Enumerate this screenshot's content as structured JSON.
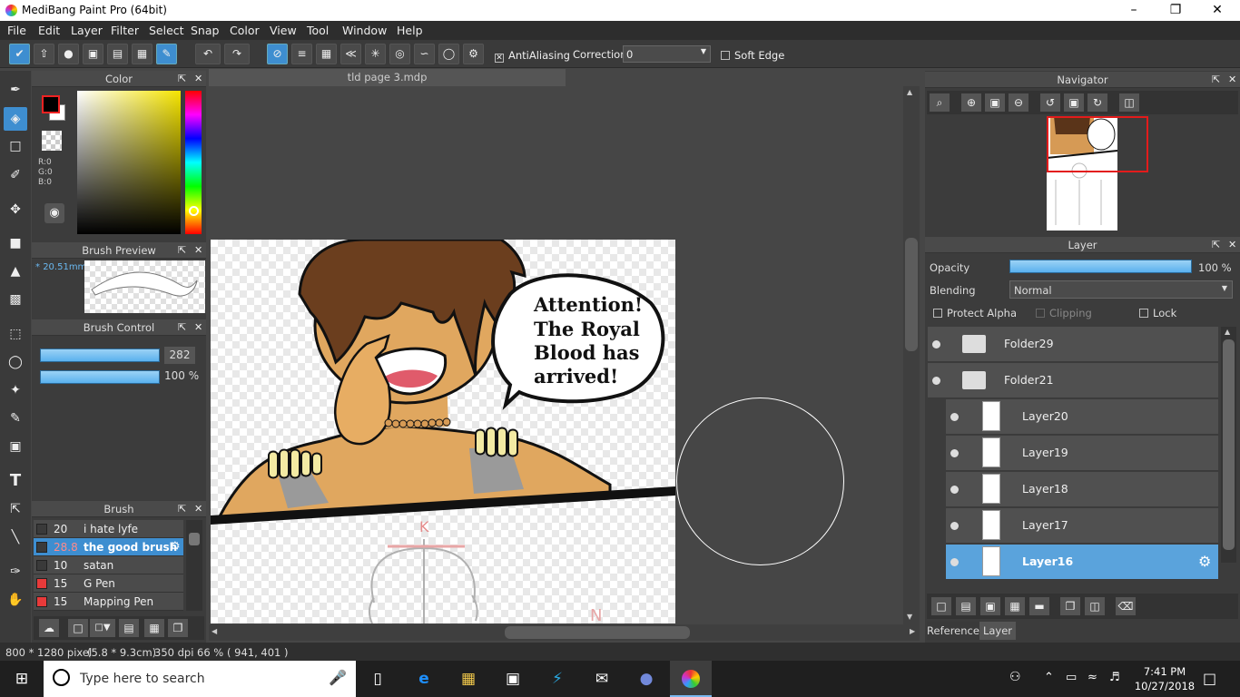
{
  "window": {
    "title": "MediBang Paint Pro (64bit)"
  },
  "menu": [
    "File",
    "Edit",
    "Layer",
    "Filter",
    "Select",
    "Snap",
    "Color",
    "View",
    "Tool",
    "Window",
    "Help"
  ],
  "toolbar": {
    "antialiasing_label": "AntiAliasing",
    "correction_label": "Correction",
    "correction_value": "0",
    "soft_edge_label": "Soft Edge"
  },
  "color_panel": {
    "title": "Color",
    "r": "R:0",
    "g": "G:0",
    "b": "B:0"
  },
  "brush_preview": {
    "title": "Brush Preview",
    "size": "20.51mm"
  },
  "brush_control": {
    "title": "Brush Control",
    "size_value": "282",
    "opacity_value": "100 %"
  },
  "brush_panel": {
    "title": "Brush",
    "items": [
      {
        "size": "20",
        "name": "i hate lyfe",
        "color": "#3a3a3a"
      },
      {
        "size": "28.8",
        "name": "the good brush",
        "color": "#3a3a3a"
      },
      {
        "size": "10",
        "name": "satan",
        "color": "#3a3a3a"
      },
      {
        "size": "15",
        "name": "G Pen",
        "color": "#e83a3a"
      },
      {
        "size": "15",
        "name": "Mapping Pen",
        "color": "#e83a3a"
      }
    ]
  },
  "document": {
    "tab": "tld page 3.mdp",
    "speech": [
      "Attention!",
      "The Royal",
      "Blood has",
      "arrived!"
    ],
    "sketch_letters": [
      "K",
      "N"
    ]
  },
  "navigator": {
    "title": "Navigator"
  },
  "layer_panel": {
    "title": "Layer",
    "opacity_label": "Opacity",
    "opacity_value": "100 %",
    "blending_label": "Blending",
    "blending_value": "Normal",
    "protect_alpha": "Protect Alpha",
    "clipping": "Clipping",
    "lock": "Lock",
    "layers": [
      "Folder29",
      "Folder21",
      "Layer20",
      "Layer19",
      "Layer18",
      "Layer17",
      "Layer16"
    ],
    "tabs": [
      "Reference",
      "Layer"
    ]
  },
  "status": {
    "dimensions": "800 * 1280 pixel",
    "physical": "(5.8 * 9.3cm)",
    "dpi": "350 dpi",
    "zoom": "66 %",
    "cursor": "( 941, 401 )"
  },
  "taskbar": {
    "search_placeholder": "Type here to search",
    "time": "7:41 PM",
    "date": "10/27/2018"
  }
}
